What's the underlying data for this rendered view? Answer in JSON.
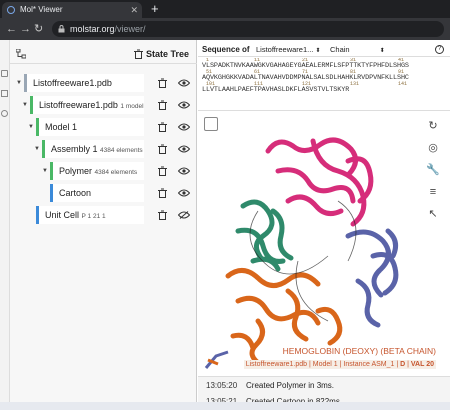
{
  "browser": {
    "tab_title": "Mol* Viewer",
    "url_domain": "molstar.org",
    "url_path": "/viewer/"
  },
  "state_tree": {
    "title": "State Tree",
    "nodes": [
      {
        "label": "Listoffreeware1.pdb",
        "small": "",
        "color": "#9aa7b5"
      },
      {
        "label": "Listoffreeware1.pdb",
        "small": "1 model",
        "color": "#4ab866"
      },
      {
        "label": "Model 1",
        "small": "",
        "color": "#4ab866"
      },
      {
        "label": "Assembly 1",
        "small": "4384 elements",
        "color": "#4ab866"
      },
      {
        "label": "Polymer",
        "small": "4384 elements",
        "color": "#4ab866"
      },
      {
        "label": "Cartoon",
        "small": "",
        "color": "#3b8ad9"
      },
      {
        "label": "Unit Cell",
        "small": "P 1 21 1",
        "color": "#3b8ad9"
      }
    ]
  },
  "sequence": {
    "label": "Sequence of",
    "structure_select": "Listoffreeware1...",
    "unit_select": "Chain",
    "numbers": [
      "1",
      "11",
      "21",
      "31",
      "41",
      "51",
      "61",
      "71",
      "81",
      "91",
      "101",
      "111",
      "121",
      "131",
      "141"
    ],
    "lines": [
      "VLSPADKTNVKAAWGKVGAHAGEYGAEALERMFLSFPTTKTYFPHFDLSHGS",
      "AQVKGHGKKVADALTNAVAHVDDMPNALSALSDLHAHKLRVDPVNFKLLSHC",
      "LLVTLAAHLPAEFTPAVHASLDKFLASVSTVLTSKYR"
    ]
  },
  "viewport": {
    "protein_name": "HEMOGLOBIN (DEOXY) (BETA CHAIN)",
    "detail_file": "Listoffreeware1.pdb",
    "detail_model": "Model 1",
    "detail_instance": "Instance ASM_1",
    "detail_chain": "D",
    "detail_residue": "VAL 20",
    "colors": {
      "pink": "#d62d7a",
      "orange": "#d9661a",
      "green": "#2f8a6b",
      "blue": "#5a63a8"
    }
  },
  "log": [
    {
      "time": "13:05:20",
      "message": "Created Polymer in 3ms."
    },
    {
      "time": "13:05:21",
      "message": "Created Cartoon in 822ms."
    }
  ]
}
